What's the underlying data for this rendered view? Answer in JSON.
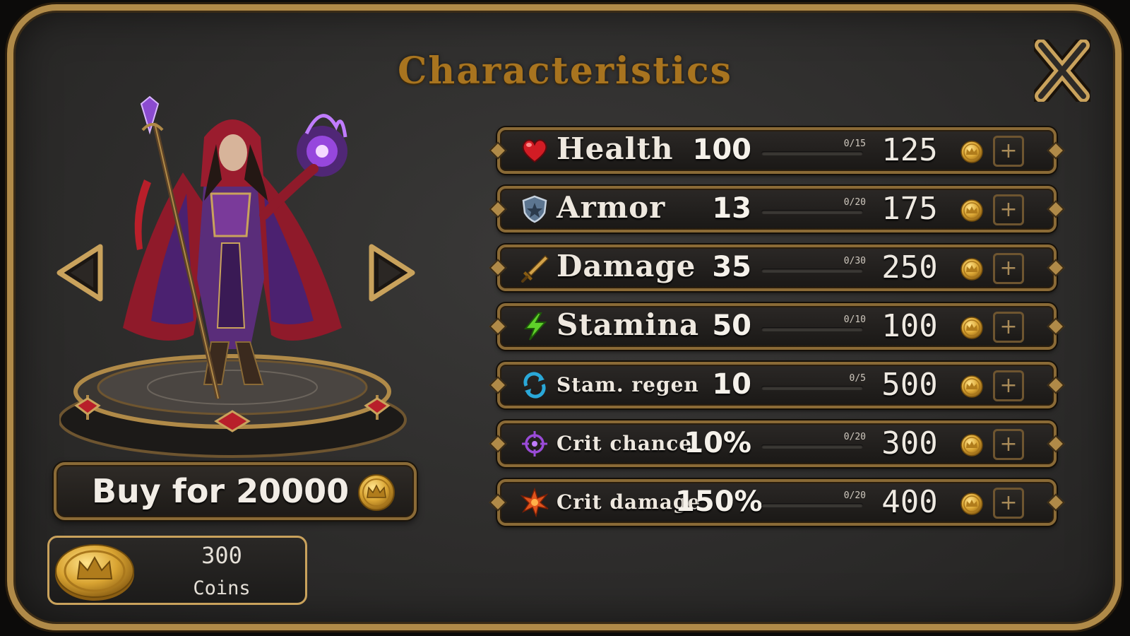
{
  "dialog": {
    "title": "Characteristics"
  },
  "character": {
    "name": "sorceress",
    "buy_label": "Buy for 20000",
    "buy_price": 20000
  },
  "wallet": {
    "amount": "300",
    "label": "Coins"
  },
  "icons": {
    "close": "close-icon",
    "prev": "arrow-left-icon",
    "next": "arrow-right-icon",
    "coin": "crown-coin-icon"
  },
  "colors": {
    "accent_gold": "#b08a48",
    "title_gold": "#a8741f",
    "panel_bg": "#2e2d2c"
  },
  "stats": [
    {
      "name": "Health",
      "value": "100",
      "progress": "0/15",
      "fill": 0,
      "cost": "125",
      "icon": "heart-icon",
      "size": "big"
    },
    {
      "name": "Armor",
      "value": "13",
      "progress": "0/20",
      "fill": 0,
      "cost": "175",
      "icon": "shield-icon",
      "size": "big"
    },
    {
      "name": "Damage",
      "value": "35",
      "progress": "0/30",
      "fill": 0,
      "cost": "250",
      "icon": "sword-icon",
      "size": "big"
    },
    {
      "name": "Stamina",
      "value": "50",
      "progress": "0/10",
      "fill": 0,
      "cost": "100",
      "icon": "lightning-icon",
      "size": "big"
    },
    {
      "name": "Stam. regen",
      "value": "10",
      "progress": "0/5",
      "fill": 0,
      "cost": "500",
      "icon": "regen-icon",
      "size": "small"
    },
    {
      "name": "Crit chance",
      "value": "10%",
      "progress": "0/20",
      "fill": 0,
      "cost": "300",
      "icon": "crosshair-icon",
      "size": "small"
    },
    {
      "name": "Crit damage",
      "value": "150%",
      "progress": "0/20",
      "fill": 0,
      "cost": "400",
      "icon": "burst-icon",
      "size": "small"
    }
  ],
  "plus_label": "+"
}
